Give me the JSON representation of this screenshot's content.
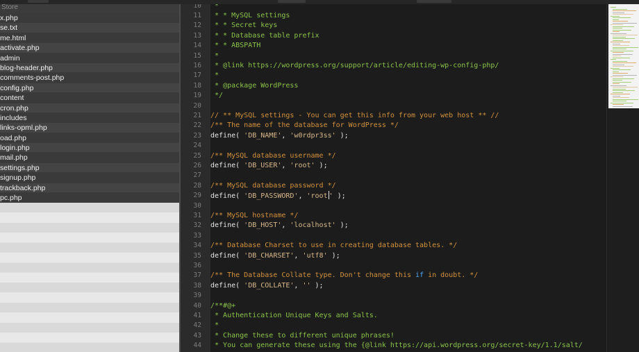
{
  "sidebar": {
    "header": "Store",
    "files": [
      "x.php",
      "se.txt",
      "me.html",
      "activate.php",
      "admin",
      "blog-header.php",
      "comments-post.php",
      "config.php",
      "content",
      "cron.php",
      "includes",
      "links-opml.php",
      "oad.php",
      "login.php",
      "mail.php",
      "settings.php",
      "signup.php",
      "trackback.php",
      "pc.php"
    ]
  },
  "editor": {
    "lines": [
      {
        "n": "10",
        "parts": [
          {
            "t": " *",
            "c": "cmt"
          }
        ]
      },
      {
        "n": "11",
        "parts": [
          {
            "t": " * * MySQL settings",
            "c": "cmt"
          }
        ]
      },
      {
        "n": "12",
        "parts": [
          {
            "t": " * * Secret keys",
            "c": "cmt"
          }
        ]
      },
      {
        "n": "13",
        "parts": [
          {
            "t": " * * Database table prefix",
            "c": "cmt"
          }
        ]
      },
      {
        "n": "14",
        "parts": [
          {
            "t": " * * ABSPATH",
            "c": "cmt"
          }
        ]
      },
      {
        "n": "15",
        "parts": [
          {
            "t": " *",
            "c": "cmt"
          }
        ]
      },
      {
        "n": "16",
        "parts": [
          {
            "t": " * @link https://wordpress.org/support/article/editing-wp-config-php/",
            "c": "cmt"
          }
        ]
      },
      {
        "n": "17",
        "parts": [
          {
            "t": " *",
            "c": "cmt"
          }
        ]
      },
      {
        "n": "18",
        "parts": [
          {
            "t": " * @package WordPress",
            "c": "cmt"
          }
        ]
      },
      {
        "n": "19",
        "parts": [
          {
            "t": " */",
            "c": "cmt"
          }
        ]
      },
      {
        "n": "20",
        "parts": []
      },
      {
        "n": "21",
        "parts": [
          {
            "t": "// ** MySQL settings - You can get this info from your web host ** //",
            "c": "cmt2"
          }
        ]
      },
      {
        "n": "22",
        "parts": [
          {
            "t": "/** The name of the database for WordPress */",
            "c": "cmt2"
          }
        ]
      },
      {
        "n": "23",
        "parts": [
          {
            "t": "define( ",
            "c": "plain"
          },
          {
            "t": "'DB_NAME'",
            "c": "str"
          },
          {
            "t": ", ",
            "c": "plain"
          },
          {
            "t": "'w0rdpr3ss'",
            "c": "str"
          },
          {
            "t": " );",
            "c": "plain"
          }
        ]
      },
      {
        "n": "24",
        "parts": []
      },
      {
        "n": "25",
        "parts": [
          {
            "t": "/** MySQL database username */",
            "c": "cmt2"
          }
        ]
      },
      {
        "n": "26",
        "parts": [
          {
            "t": "define( ",
            "c": "plain"
          },
          {
            "t": "'DB_USER'",
            "c": "str"
          },
          {
            "t": ", ",
            "c": "plain"
          },
          {
            "t": "'root'",
            "c": "str"
          },
          {
            "t": " );",
            "c": "plain"
          }
        ]
      },
      {
        "n": "27",
        "parts": []
      },
      {
        "n": "28",
        "parts": [
          {
            "t": "/** MySQL database password */",
            "c": "cmt2"
          }
        ]
      },
      {
        "n": "29",
        "parts": [
          {
            "t": "define( ",
            "c": "plain"
          },
          {
            "t": "'DB_PASSWORD'",
            "c": "str"
          },
          {
            "t": ", ",
            "c": "plain"
          },
          {
            "t": "'root",
            "c": "str"
          },
          {
            "t": "|",
            "c": "cursor"
          },
          {
            "t": "'",
            "c": "str"
          },
          {
            "t": " );",
            "c": "plain"
          }
        ]
      },
      {
        "n": "30",
        "parts": []
      },
      {
        "n": "31",
        "parts": [
          {
            "t": "/** MySQL hostname */",
            "c": "cmt2"
          }
        ]
      },
      {
        "n": "32",
        "parts": [
          {
            "t": "define( ",
            "c": "plain"
          },
          {
            "t": "'DB_HOST'",
            "c": "str"
          },
          {
            "t": ", ",
            "c": "plain"
          },
          {
            "t": "'localhost'",
            "c": "str"
          },
          {
            "t": " );",
            "c": "plain"
          }
        ]
      },
      {
        "n": "33",
        "parts": []
      },
      {
        "n": "34",
        "parts": [
          {
            "t": "/** Database Charset to use in creating database tables. */",
            "c": "cmt2"
          }
        ]
      },
      {
        "n": "35",
        "parts": [
          {
            "t": "define( ",
            "c": "plain"
          },
          {
            "t": "'DB_CHARSET'",
            "c": "str"
          },
          {
            "t": ", ",
            "c": "plain"
          },
          {
            "t": "'utf8'",
            "c": "str"
          },
          {
            "t": " );",
            "c": "plain"
          }
        ]
      },
      {
        "n": "36",
        "parts": []
      },
      {
        "n": "37",
        "parts": [
          {
            "t": "/** The Database Collate type. Don't change this ",
            "c": "cmt2"
          },
          {
            "t": "if",
            "c": "kw"
          },
          {
            "t": " in doubt. */",
            "c": "cmt2"
          }
        ]
      },
      {
        "n": "38",
        "parts": [
          {
            "t": "define( ",
            "c": "plain"
          },
          {
            "t": "'DB_COLLATE'",
            "c": "str"
          },
          {
            "t": ", ",
            "c": "plain"
          },
          {
            "t": "''",
            "c": "str"
          },
          {
            "t": " );",
            "c": "plain"
          }
        ]
      },
      {
        "n": "39",
        "parts": []
      },
      {
        "n": "40",
        "parts": [
          {
            "t": "/**#@+",
            "c": "cmt"
          }
        ]
      },
      {
        "n": "41",
        "parts": [
          {
            "t": " * Authentication Unique Keys and Salts.",
            "c": "cmt"
          }
        ]
      },
      {
        "n": "42",
        "parts": [
          {
            "t": " *",
            "c": "cmt"
          }
        ]
      },
      {
        "n": "43",
        "parts": [
          {
            "t": " * Change these to different unique phrases!",
            "c": "cmt"
          }
        ]
      },
      {
        "n": "44",
        "parts": [
          {
            "t": " * You can generate these using the {@link https://api.wordpress.org/secret-key/1.1/salt/",
            "c": "cmt"
          }
        ]
      }
    ]
  },
  "colors": {
    "comment_green": "#8bc34a",
    "comment_orange": "#d4923d",
    "string": "#d9b98c",
    "keyword": "#4fa8ff",
    "editor_bg": "#1c1c1c",
    "sidebar_bg": "#3a3a3a"
  }
}
